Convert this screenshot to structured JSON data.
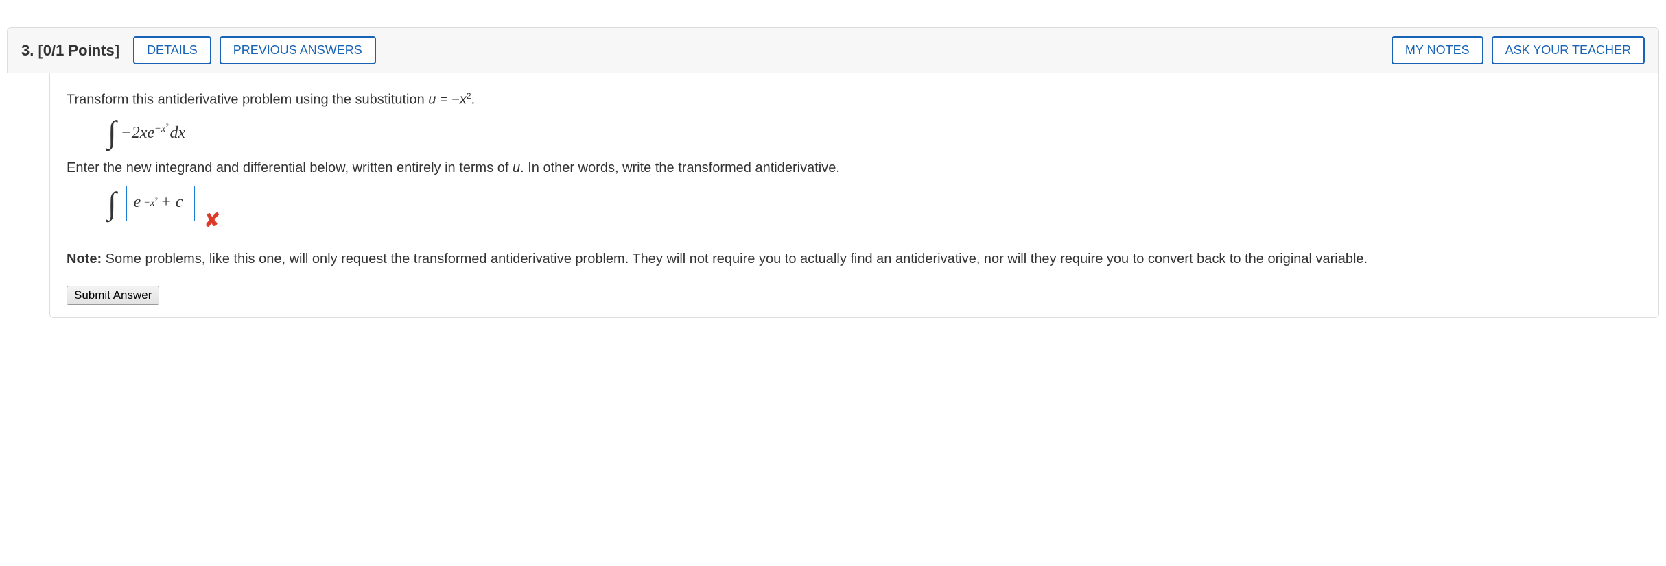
{
  "header": {
    "qnum": "3.",
    "points": "[0/1 Points]",
    "details": "DETAILS",
    "previous": "PREVIOUS ANSWERS",
    "mynotes": "MY NOTES",
    "askteacher": "ASK YOUR TEACHER"
  },
  "body": {
    "prompt_prefix": "Transform this antiderivative problem using the substitution ",
    "sub_var": "u",
    "equals": " = ",
    "sub_expr_neg": "−",
    "sub_expr_base": "x",
    "sub_expr_exp": "2",
    "period": ".",
    "integral": {
      "coef": "−2",
      "var": "x",
      "e": "e",
      "exp_neg": "−",
      "exp_base": "x",
      "exp_exp": "2",
      "dx": "dx"
    },
    "instruction_prefix": "Enter the new integrand and differential below, written entirely in terms of ",
    "instruction_var": "u",
    "instruction_suffix": ". In other words, write the transformed antiderivative.",
    "answer": {
      "e": "e",
      "exp_neg": "−",
      "exp_base": "x",
      "exp_exp": "2",
      "plus_c": " + c"
    },
    "note_label": "Note:",
    "note_text": " Some problems, like this one, will only request the transformed antiderivative problem. They will not require you to actually find an antiderivative, nor will they require you to convert back to the original variable.",
    "submit": "Submit Answer"
  }
}
